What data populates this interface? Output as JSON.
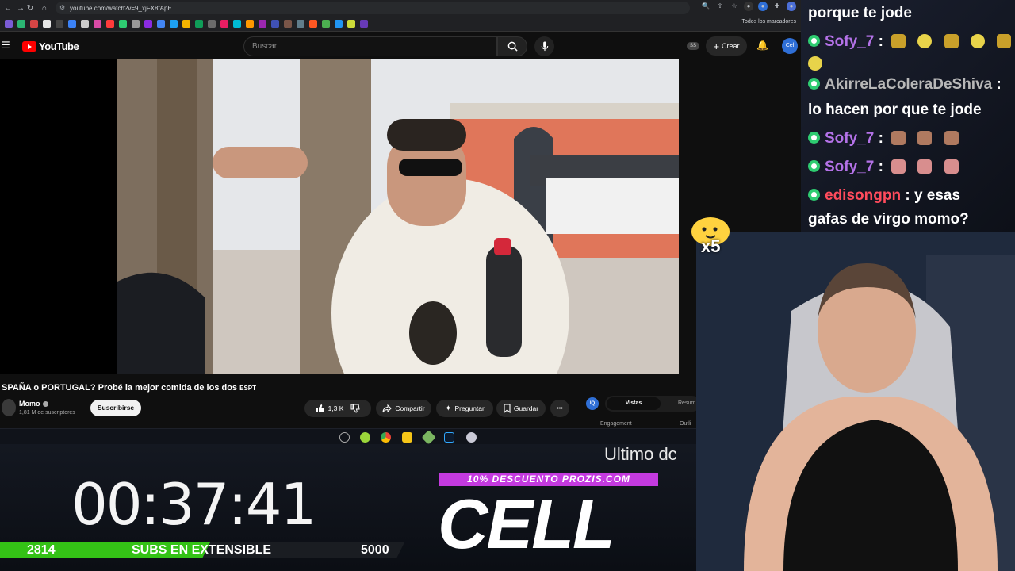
{
  "browser": {
    "url": "youtube.com/watch?v=9_xjFX8fApE",
    "bookmarks_folder": "Todos los marcadores"
  },
  "youtube": {
    "logo": "YouTube",
    "search_placeholder": "Buscar",
    "ss_badge": "SS",
    "create_label": "Crear",
    "avatar_label": "Cel"
  },
  "video": {
    "title": "SPAÑA o PORTUGAL? Probé la mejor comida de los dos",
    "title_suffix": "ESPT",
    "channel": "Momo",
    "subscribers": "1,81 M de suscriptores",
    "subscribe_label": "Suscribirse",
    "likes": "1,3 K",
    "share_label": "Compartir",
    "ask_label": "Preguntar",
    "save_label": "Guardar",
    "more_label": "•••"
  },
  "iq_panel": {
    "badge": "IQ",
    "tab_active": "Vistas",
    "tab_other": "Resum",
    "metric_left": "Engagement",
    "metric_right": "Outli"
  },
  "stream_overlay": {
    "timer": "00:37:41",
    "subs_current": "2814",
    "subs_label": "SUBS EN EXTENSIBLE",
    "subs_goal": "5000",
    "subs_progress_fraction": 0.3,
    "ticker": "Ultimo dc",
    "promo": "10% DESCUENTO PROZIS.COM",
    "brand": "CELL"
  },
  "chat": {
    "messages": [
      {
        "user": "",
        "text": "porque te jode",
        "color": "#ffffff"
      },
      {
        "user": "Sofy_7",
        "text": " :",
        "color": "#b472e8",
        "emotes": 6
      },
      {
        "user": "AkirreLaColeraDeShiva",
        "text": " :",
        "color": "#b8b8b8"
      },
      {
        "user": "",
        "text": "lo hacen por que te jode",
        "color": "#ffffff"
      },
      {
        "user": "Sofy_7",
        "text": " :",
        "color": "#b472e8",
        "emotes": 3
      },
      {
        "user": "Sofy_7",
        "text": " :",
        "color": "#b472e8",
        "emotes": 3
      },
      {
        "user": "edisongpn",
        "text": " : y esas",
        "color": "#ff4b5c"
      },
      {
        "user": "",
        "text": "gafas de virgo momo?",
        "color": "#ffffff"
      }
    ]
  },
  "reaction_badge": "x5",
  "colors": {
    "youtube_red": "#ff0000",
    "progress_green": "#34c216",
    "promo_purple": "#c43adf",
    "chat_badge_green": "#2ecc71"
  }
}
